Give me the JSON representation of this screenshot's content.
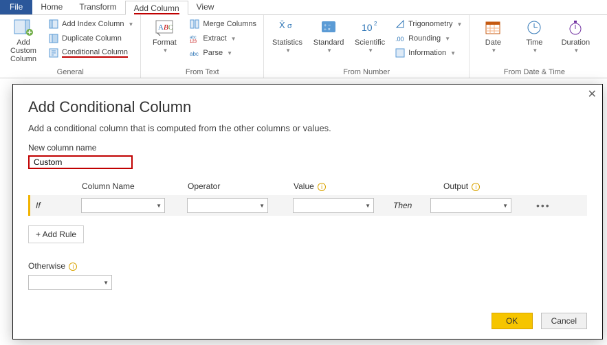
{
  "tabs": {
    "file": "File",
    "home": "Home",
    "transform": "Transform",
    "add_column": "Add Column",
    "view": "View"
  },
  "ribbon": {
    "general": {
      "label": "General",
      "add_custom_column": "Add Custom\nColumn",
      "add_index_column": "Add Index Column",
      "duplicate_column": "Duplicate Column",
      "conditional_column": "Conditional Column"
    },
    "from_text": {
      "label": "From Text",
      "format": "Format",
      "merge_columns": "Merge Columns",
      "extract": "Extract",
      "parse": "Parse"
    },
    "from_number": {
      "label": "From Number",
      "statistics": "Statistics",
      "standard": "Standard",
      "scientific": "Scientific",
      "trigonometry": "Trigonometry",
      "rounding": "Rounding",
      "information": "Information"
    },
    "from_date_time": {
      "label": "From Date & Time",
      "date": "Date",
      "time": "Time",
      "duration": "Duration"
    }
  },
  "dialog": {
    "title": "Add Conditional Column",
    "subtitle": "Add a conditional column that is computed from the other columns or values.",
    "new_column_name_label": "New column name",
    "new_column_name_value": "Custom",
    "headers": {
      "column_name": "Column Name",
      "operator": "Operator",
      "value": "Value",
      "output": "Output"
    },
    "rule": {
      "if": "If",
      "then": "Then"
    },
    "add_rule": "+ Add Rule",
    "otherwise": "Otherwise",
    "ok": "OK",
    "cancel": "Cancel"
  }
}
